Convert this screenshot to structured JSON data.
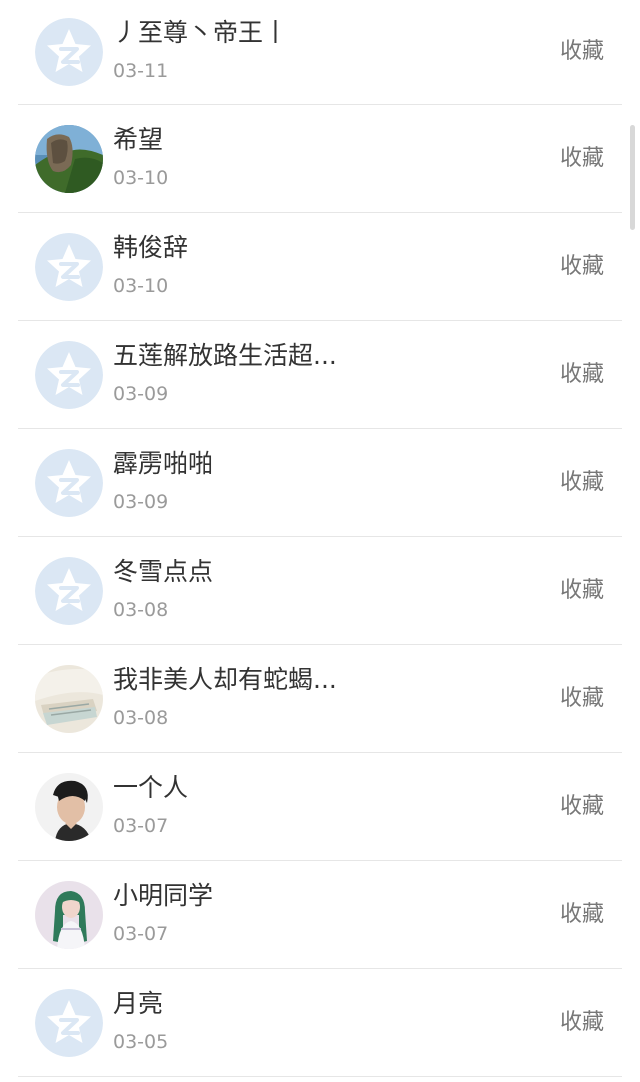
{
  "contacts": [
    {
      "name": "丿至尊丶帝王丨",
      "date": "03-11",
      "action": "收藏",
      "avatar": "default-star-avatar"
    },
    {
      "name": "希望",
      "date": "03-10",
      "action": "收藏",
      "avatar": "landscape-rock-photo"
    },
    {
      "name": "韩俊辞",
      "date": "03-10",
      "action": "收藏",
      "avatar": "default-star-avatar"
    },
    {
      "name": "五莲解放路生活超...",
      "date": "03-09",
      "action": "收藏",
      "avatar": "default-star-avatar"
    },
    {
      "name": "霹雳啪啪",
      "date": "03-09",
      "action": "收藏",
      "avatar": "default-star-avatar"
    },
    {
      "name": "冬雪点点",
      "date": "03-08",
      "action": "收藏",
      "avatar": "default-star-avatar"
    },
    {
      "name": "我非美人却有蛇蝎...",
      "date": "03-08",
      "action": "收藏",
      "avatar": "book-photo"
    },
    {
      "name": "一个人",
      "date": "03-07",
      "action": "收藏",
      "avatar": "man-portrait-photo"
    },
    {
      "name": "小明同学",
      "date": "03-07",
      "action": "收藏",
      "avatar": "girl-portrait-photo"
    },
    {
      "name": "月亮",
      "date": "03-05",
      "action": "收藏",
      "avatar": "default-star-avatar"
    }
  ],
  "colors": {
    "default_avatar_bg": "#dbe7f4",
    "default_avatar_fg": "#ffffff",
    "name_text": "#333333",
    "date_text": "#9a9a9a",
    "action_text": "#777777",
    "divider": "#e6e6e6"
  }
}
